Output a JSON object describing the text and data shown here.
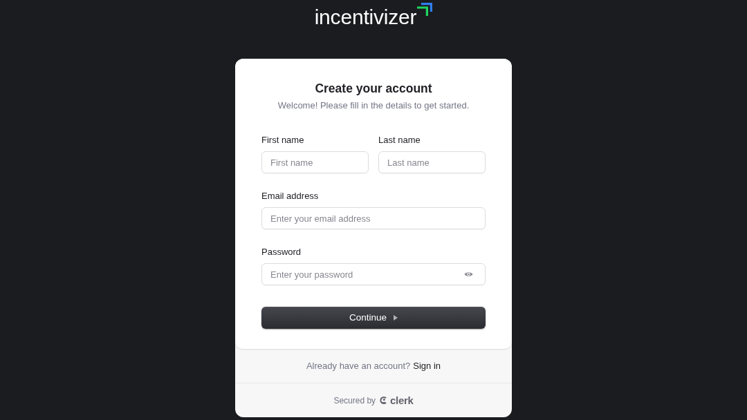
{
  "logo": {
    "text": "incentivizer"
  },
  "card": {
    "title": "Create your account",
    "subtitle": "Welcome! Please fill in the details to get started."
  },
  "fields": [
    {
      "kind": "half",
      "label": "First name",
      "placeholder": "First name"
    },
    {
      "kind": "half",
      "label": "Last name",
      "placeholder": "Last name"
    },
    {
      "kind": "email",
      "label": "Email address",
      "placeholder": "Enter your email address"
    },
    {
      "kind": "password",
      "label": "Password",
      "placeholder": "Enter your password"
    }
  ],
  "submit": {
    "label": "Continue"
  },
  "footer": {
    "prompt": "Already have an account?",
    "link": "Sign in"
  },
  "secured": {
    "text": "Secured by",
    "brand": "clerk"
  }
}
